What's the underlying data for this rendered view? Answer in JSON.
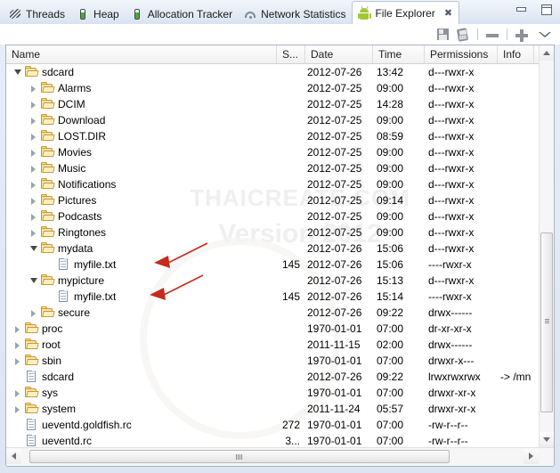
{
  "window": {
    "minimize_label": "Minimize",
    "maximize_label": "Maximize"
  },
  "tabs": [
    {
      "label": "Threads",
      "icon": "threads-icon",
      "active": false
    },
    {
      "label": "Heap",
      "icon": "heap-icon",
      "active": false
    },
    {
      "label": "Allocation Tracker",
      "icon": "allocation-tracker-icon",
      "active": false
    },
    {
      "label": "Network Statistics",
      "icon": "network-statistics-icon",
      "active": false
    },
    {
      "label": "File Explorer",
      "icon": "android-icon",
      "active": true,
      "close": "✖"
    }
  ],
  "toolbar": {
    "buttons": [
      {
        "name": "pull-file-button",
        "title": "Pull a file from the device"
      },
      {
        "name": "push-file-button",
        "title": "Push a file onto the device"
      },
      {
        "name": "delete-button",
        "title": "Delete"
      },
      {
        "name": "new-folder-button",
        "title": "New folder"
      },
      {
        "name": "view-menu-button",
        "title": "View Menu"
      }
    ]
  },
  "columns": [
    {
      "key": "name",
      "label": "Name"
    },
    {
      "key": "size",
      "label": "S..."
    },
    {
      "key": "date",
      "label": "Date"
    },
    {
      "key": "time",
      "label": "Time"
    },
    {
      "key": "permissions",
      "label": "Permissions"
    },
    {
      "key": "info",
      "label": "Info"
    }
  ],
  "rows": [
    {
      "name": "sdcard",
      "depth": 1,
      "type": "folder",
      "state": "expanded",
      "size": "",
      "date": "2012-07-26",
      "time": "13:42",
      "permissions": "d---rwxr-x",
      "info": ""
    },
    {
      "name": "Alarms",
      "depth": 2,
      "type": "folder",
      "state": "collapsed",
      "size": "",
      "date": "2012-07-25",
      "time": "09:00",
      "permissions": "d---rwxr-x",
      "info": ""
    },
    {
      "name": "DCIM",
      "depth": 2,
      "type": "folder",
      "state": "collapsed",
      "size": "",
      "date": "2012-07-25",
      "time": "14:28",
      "permissions": "d---rwxr-x",
      "info": ""
    },
    {
      "name": "Download",
      "depth": 2,
      "type": "folder",
      "state": "collapsed",
      "size": "",
      "date": "2012-07-25",
      "time": "09:00",
      "permissions": "d---rwxr-x",
      "info": ""
    },
    {
      "name": "LOST.DIR",
      "depth": 2,
      "type": "folder",
      "state": "collapsed",
      "size": "",
      "date": "2012-07-25",
      "time": "08:59",
      "permissions": "d---rwxr-x",
      "info": ""
    },
    {
      "name": "Movies",
      "depth": 2,
      "type": "folder",
      "state": "collapsed",
      "size": "",
      "date": "2012-07-25",
      "time": "09:00",
      "permissions": "d---rwxr-x",
      "info": ""
    },
    {
      "name": "Music",
      "depth": 2,
      "type": "folder",
      "state": "collapsed",
      "size": "",
      "date": "2012-07-25",
      "time": "09:00",
      "permissions": "d---rwxr-x",
      "info": ""
    },
    {
      "name": "Notifications",
      "depth": 2,
      "type": "folder",
      "state": "collapsed",
      "size": "",
      "date": "2012-07-25",
      "time": "09:00",
      "permissions": "d---rwxr-x",
      "info": ""
    },
    {
      "name": "Pictures",
      "depth": 2,
      "type": "folder",
      "state": "collapsed",
      "size": "",
      "date": "2012-07-25",
      "time": "09:14",
      "permissions": "d---rwxr-x",
      "info": ""
    },
    {
      "name": "Podcasts",
      "depth": 2,
      "type": "folder",
      "state": "collapsed",
      "size": "",
      "date": "2012-07-25",
      "time": "09:00",
      "permissions": "d---rwxr-x",
      "info": ""
    },
    {
      "name": "Ringtones",
      "depth": 2,
      "type": "folder",
      "state": "collapsed",
      "size": "",
      "date": "2012-07-25",
      "time": "09:00",
      "permissions": "d---rwxr-x",
      "info": ""
    },
    {
      "name": "mydata",
      "depth": 2,
      "type": "folder",
      "state": "expanded",
      "size": "",
      "date": "2012-07-26",
      "time": "15:06",
      "permissions": "d---rwxr-x",
      "info": ""
    },
    {
      "name": "myfile.txt",
      "depth": 3,
      "type": "file",
      "state": "none",
      "size": "145",
      "date": "2012-07-26",
      "time": "15:06",
      "permissions": "----rwxr-x",
      "info": ""
    },
    {
      "name": "mypicture",
      "depth": 2,
      "type": "folder",
      "state": "expanded",
      "size": "",
      "date": "2012-07-26",
      "time": "15:13",
      "permissions": "d---rwxr-x",
      "info": ""
    },
    {
      "name": "myfile.txt",
      "depth": 3,
      "type": "file",
      "state": "none",
      "size": "145",
      "date": "2012-07-26",
      "time": "15:14",
      "permissions": "----rwxr-x",
      "info": ""
    },
    {
      "name": "secure",
      "depth": 2,
      "type": "folder",
      "state": "collapsed",
      "size": "",
      "date": "2012-07-26",
      "time": "09:22",
      "permissions": "drwx------",
      "info": ""
    },
    {
      "name": "proc",
      "depth": 1,
      "type": "folder",
      "state": "collapsed",
      "size": "",
      "date": "1970-01-01",
      "time": "07:00",
      "permissions": "dr-xr-xr-x",
      "info": ""
    },
    {
      "name": "root",
      "depth": 1,
      "type": "folder",
      "state": "collapsed",
      "size": "",
      "date": "2011-11-15",
      "time": "02:00",
      "permissions": "drwx------",
      "info": ""
    },
    {
      "name": "sbin",
      "depth": 1,
      "type": "folder",
      "state": "collapsed",
      "size": "",
      "date": "1970-01-01",
      "time": "07:00",
      "permissions": "drwxr-x---",
      "info": ""
    },
    {
      "name": "sdcard",
      "depth": 1,
      "type": "file",
      "state": "none",
      "size": "",
      "date": "2012-07-26",
      "time": "09:22",
      "permissions": "lrwxrwxrwx",
      "info": "-> /mn"
    },
    {
      "name": "sys",
      "depth": 1,
      "type": "folder",
      "state": "collapsed",
      "size": "",
      "date": "1970-01-01",
      "time": "07:00",
      "permissions": "drwxr-xr-x",
      "info": ""
    },
    {
      "name": "system",
      "depth": 1,
      "type": "folder",
      "state": "collapsed",
      "size": "",
      "date": "2011-11-24",
      "time": "05:57",
      "permissions": "drwxr-xr-x",
      "info": ""
    },
    {
      "name": "ueventd.goldfish.rc",
      "depth": 1,
      "type": "file",
      "state": "none",
      "size": "272",
      "date": "1970-01-01",
      "time": "07:00",
      "permissions": "-rw-r--r--",
      "info": ""
    },
    {
      "name": "ueventd.rc",
      "depth": 1,
      "type": "file",
      "state": "none",
      "size": "3...",
      "date": "1970-01-01",
      "time": "07:00",
      "permissions": "-rw-r--r--",
      "info": ""
    }
  ],
  "annotations": {
    "arrow_color": "#c42b1c",
    "arrows": [
      {
        "name": "arrow-to-mydata-myfile",
        "target_row": 12
      },
      {
        "name": "arrow-to-mypicture-myfile",
        "target_row": 14
      }
    ]
  },
  "watermark": {
    "line1": "THAICREATE.COM",
    "line2": "Version 2012"
  },
  "colors": {
    "accent": "#a4c639",
    "folder": "#fbe3a2",
    "panel_border": "#a9b4c2",
    "chrome": "#dce5f1"
  }
}
